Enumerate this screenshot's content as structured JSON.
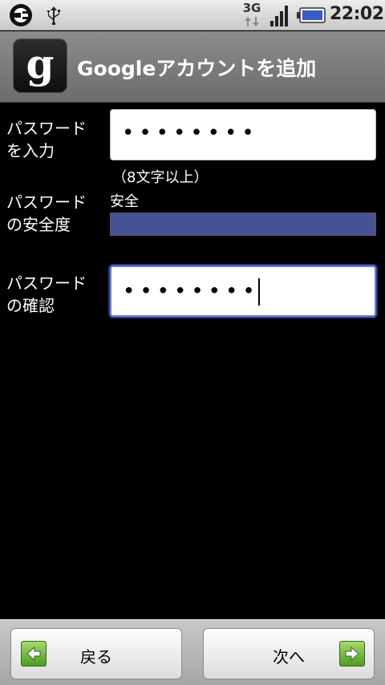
{
  "status_bar": {
    "network_type": "3G",
    "time": "22:02",
    "icons": [
      "usb-debugging-icon",
      "usb-icon",
      "data-activity-icon",
      "signal-strength-icon",
      "battery-icon"
    ]
  },
  "title_bar": {
    "title": "Googleアカウントを追加",
    "logo_letter": "g"
  },
  "form": {
    "password_label": "パスワード\nを入力",
    "password_value": "••••••••",
    "password_hint": "（8文字以上）",
    "strength_label": "パスワード\nの安全度",
    "strength_value": "安全",
    "strength_level": 1.0,
    "strength_color": "#475196",
    "confirm_label": "パスワード\nの確認",
    "confirm_value": "••••••••"
  },
  "buttons": {
    "back_label": "戻る",
    "next_label": "次へ"
  },
  "colors": {
    "accent_green": "#6bb43c",
    "focus_border": "#6a7fd6"
  }
}
